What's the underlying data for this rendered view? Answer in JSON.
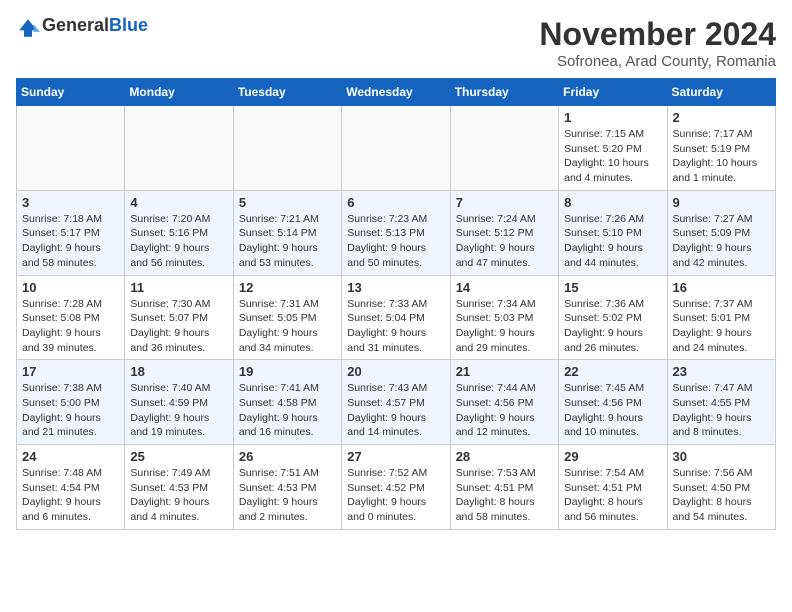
{
  "logo": {
    "line1": "General",
    "line2": "Blue"
  },
  "title": "November 2024",
  "subtitle": "Sofronea, Arad County, Romania",
  "days_of_week": [
    "Sunday",
    "Monday",
    "Tuesday",
    "Wednesday",
    "Thursday",
    "Friday",
    "Saturday"
  ],
  "weeks": [
    [
      {
        "day": "",
        "info": ""
      },
      {
        "day": "",
        "info": ""
      },
      {
        "day": "",
        "info": ""
      },
      {
        "day": "",
        "info": ""
      },
      {
        "day": "",
        "info": ""
      },
      {
        "day": "1",
        "info": "Sunrise: 7:15 AM\nSunset: 5:20 PM\nDaylight: 10 hours\nand 4 minutes."
      },
      {
        "day": "2",
        "info": "Sunrise: 7:17 AM\nSunset: 5:19 PM\nDaylight: 10 hours\nand 1 minute."
      }
    ],
    [
      {
        "day": "3",
        "info": "Sunrise: 7:18 AM\nSunset: 5:17 PM\nDaylight: 9 hours\nand 58 minutes."
      },
      {
        "day": "4",
        "info": "Sunrise: 7:20 AM\nSunset: 5:16 PM\nDaylight: 9 hours\nand 56 minutes."
      },
      {
        "day": "5",
        "info": "Sunrise: 7:21 AM\nSunset: 5:14 PM\nDaylight: 9 hours\nand 53 minutes."
      },
      {
        "day": "6",
        "info": "Sunrise: 7:23 AM\nSunset: 5:13 PM\nDaylight: 9 hours\nand 50 minutes."
      },
      {
        "day": "7",
        "info": "Sunrise: 7:24 AM\nSunset: 5:12 PM\nDaylight: 9 hours\nand 47 minutes."
      },
      {
        "day": "8",
        "info": "Sunrise: 7:26 AM\nSunset: 5:10 PM\nDaylight: 9 hours\nand 44 minutes."
      },
      {
        "day": "9",
        "info": "Sunrise: 7:27 AM\nSunset: 5:09 PM\nDaylight: 9 hours\nand 42 minutes."
      }
    ],
    [
      {
        "day": "10",
        "info": "Sunrise: 7:28 AM\nSunset: 5:08 PM\nDaylight: 9 hours\nand 39 minutes."
      },
      {
        "day": "11",
        "info": "Sunrise: 7:30 AM\nSunset: 5:07 PM\nDaylight: 9 hours\nand 36 minutes."
      },
      {
        "day": "12",
        "info": "Sunrise: 7:31 AM\nSunset: 5:05 PM\nDaylight: 9 hours\nand 34 minutes."
      },
      {
        "day": "13",
        "info": "Sunrise: 7:33 AM\nSunset: 5:04 PM\nDaylight: 9 hours\nand 31 minutes."
      },
      {
        "day": "14",
        "info": "Sunrise: 7:34 AM\nSunset: 5:03 PM\nDaylight: 9 hours\nand 29 minutes."
      },
      {
        "day": "15",
        "info": "Sunrise: 7:36 AM\nSunset: 5:02 PM\nDaylight: 9 hours\nand 26 minutes."
      },
      {
        "day": "16",
        "info": "Sunrise: 7:37 AM\nSunset: 5:01 PM\nDaylight: 9 hours\nand 24 minutes."
      }
    ],
    [
      {
        "day": "17",
        "info": "Sunrise: 7:38 AM\nSunset: 5:00 PM\nDaylight: 9 hours\nand 21 minutes."
      },
      {
        "day": "18",
        "info": "Sunrise: 7:40 AM\nSunset: 4:59 PM\nDaylight: 9 hours\nand 19 minutes."
      },
      {
        "day": "19",
        "info": "Sunrise: 7:41 AM\nSunset: 4:58 PM\nDaylight: 9 hours\nand 16 minutes."
      },
      {
        "day": "20",
        "info": "Sunrise: 7:43 AM\nSunset: 4:57 PM\nDaylight: 9 hours\nand 14 minutes."
      },
      {
        "day": "21",
        "info": "Sunrise: 7:44 AM\nSunset: 4:56 PM\nDaylight: 9 hours\nand 12 minutes."
      },
      {
        "day": "22",
        "info": "Sunrise: 7:45 AM\nSunset: 4:56 PM\nDaylight: 9 hours\nand 10 minutes."
      },
      {
        "day": "23",
        "info": "Sunrise: 7:47 AM\nSunset: 4:55 PM\nDaylight: 9 hours\nand 8 minutes."
      }
    ],
    [
      {
        "day": "24",
        "info": "Sunrise: 7:48 AM\nSunset: 4:54 PM\nDaylight: 9 hours\nand 6 minutes."
      },
      {
        "day": "25",
        "info": "Sunrise: 7:49 AM\nSunset: 4:53 PM\nDaylight: 9 hours\nand 4 minutes."
      },
      {
        "day": "26",
        "info": "Sunrise: 7:51 AM\nSunset: 4:53 PM\nDaylight: 9 hours\nand 2 minutes."
      },
      {
        "day": "27",
        "info": "Sunrise: 7:52 AM\nSunset: 4:52 PM\nDaylight: 9 hours\nand 0 minutes."
      },
      {
        "day": "28",
        "info": "Sunrise: 7:53 AM\nSunset: 4:51 PM\nDaylight: 8 hours\nand 58 minutes."
      },
      {
        "day": "29",
        "info": "Sunrise: 7:54 AM\nSunset: 4:51 PM\nDaylight: 8 hours\nand 56 minutes."
      },
      {
        "day": "30",
        "info": "Sunrise: 7:56 AM\nSunset: 4:50 PM\nDaylight: 8 hours\nand 54 minutes."
      }
    ]
  ]
}
